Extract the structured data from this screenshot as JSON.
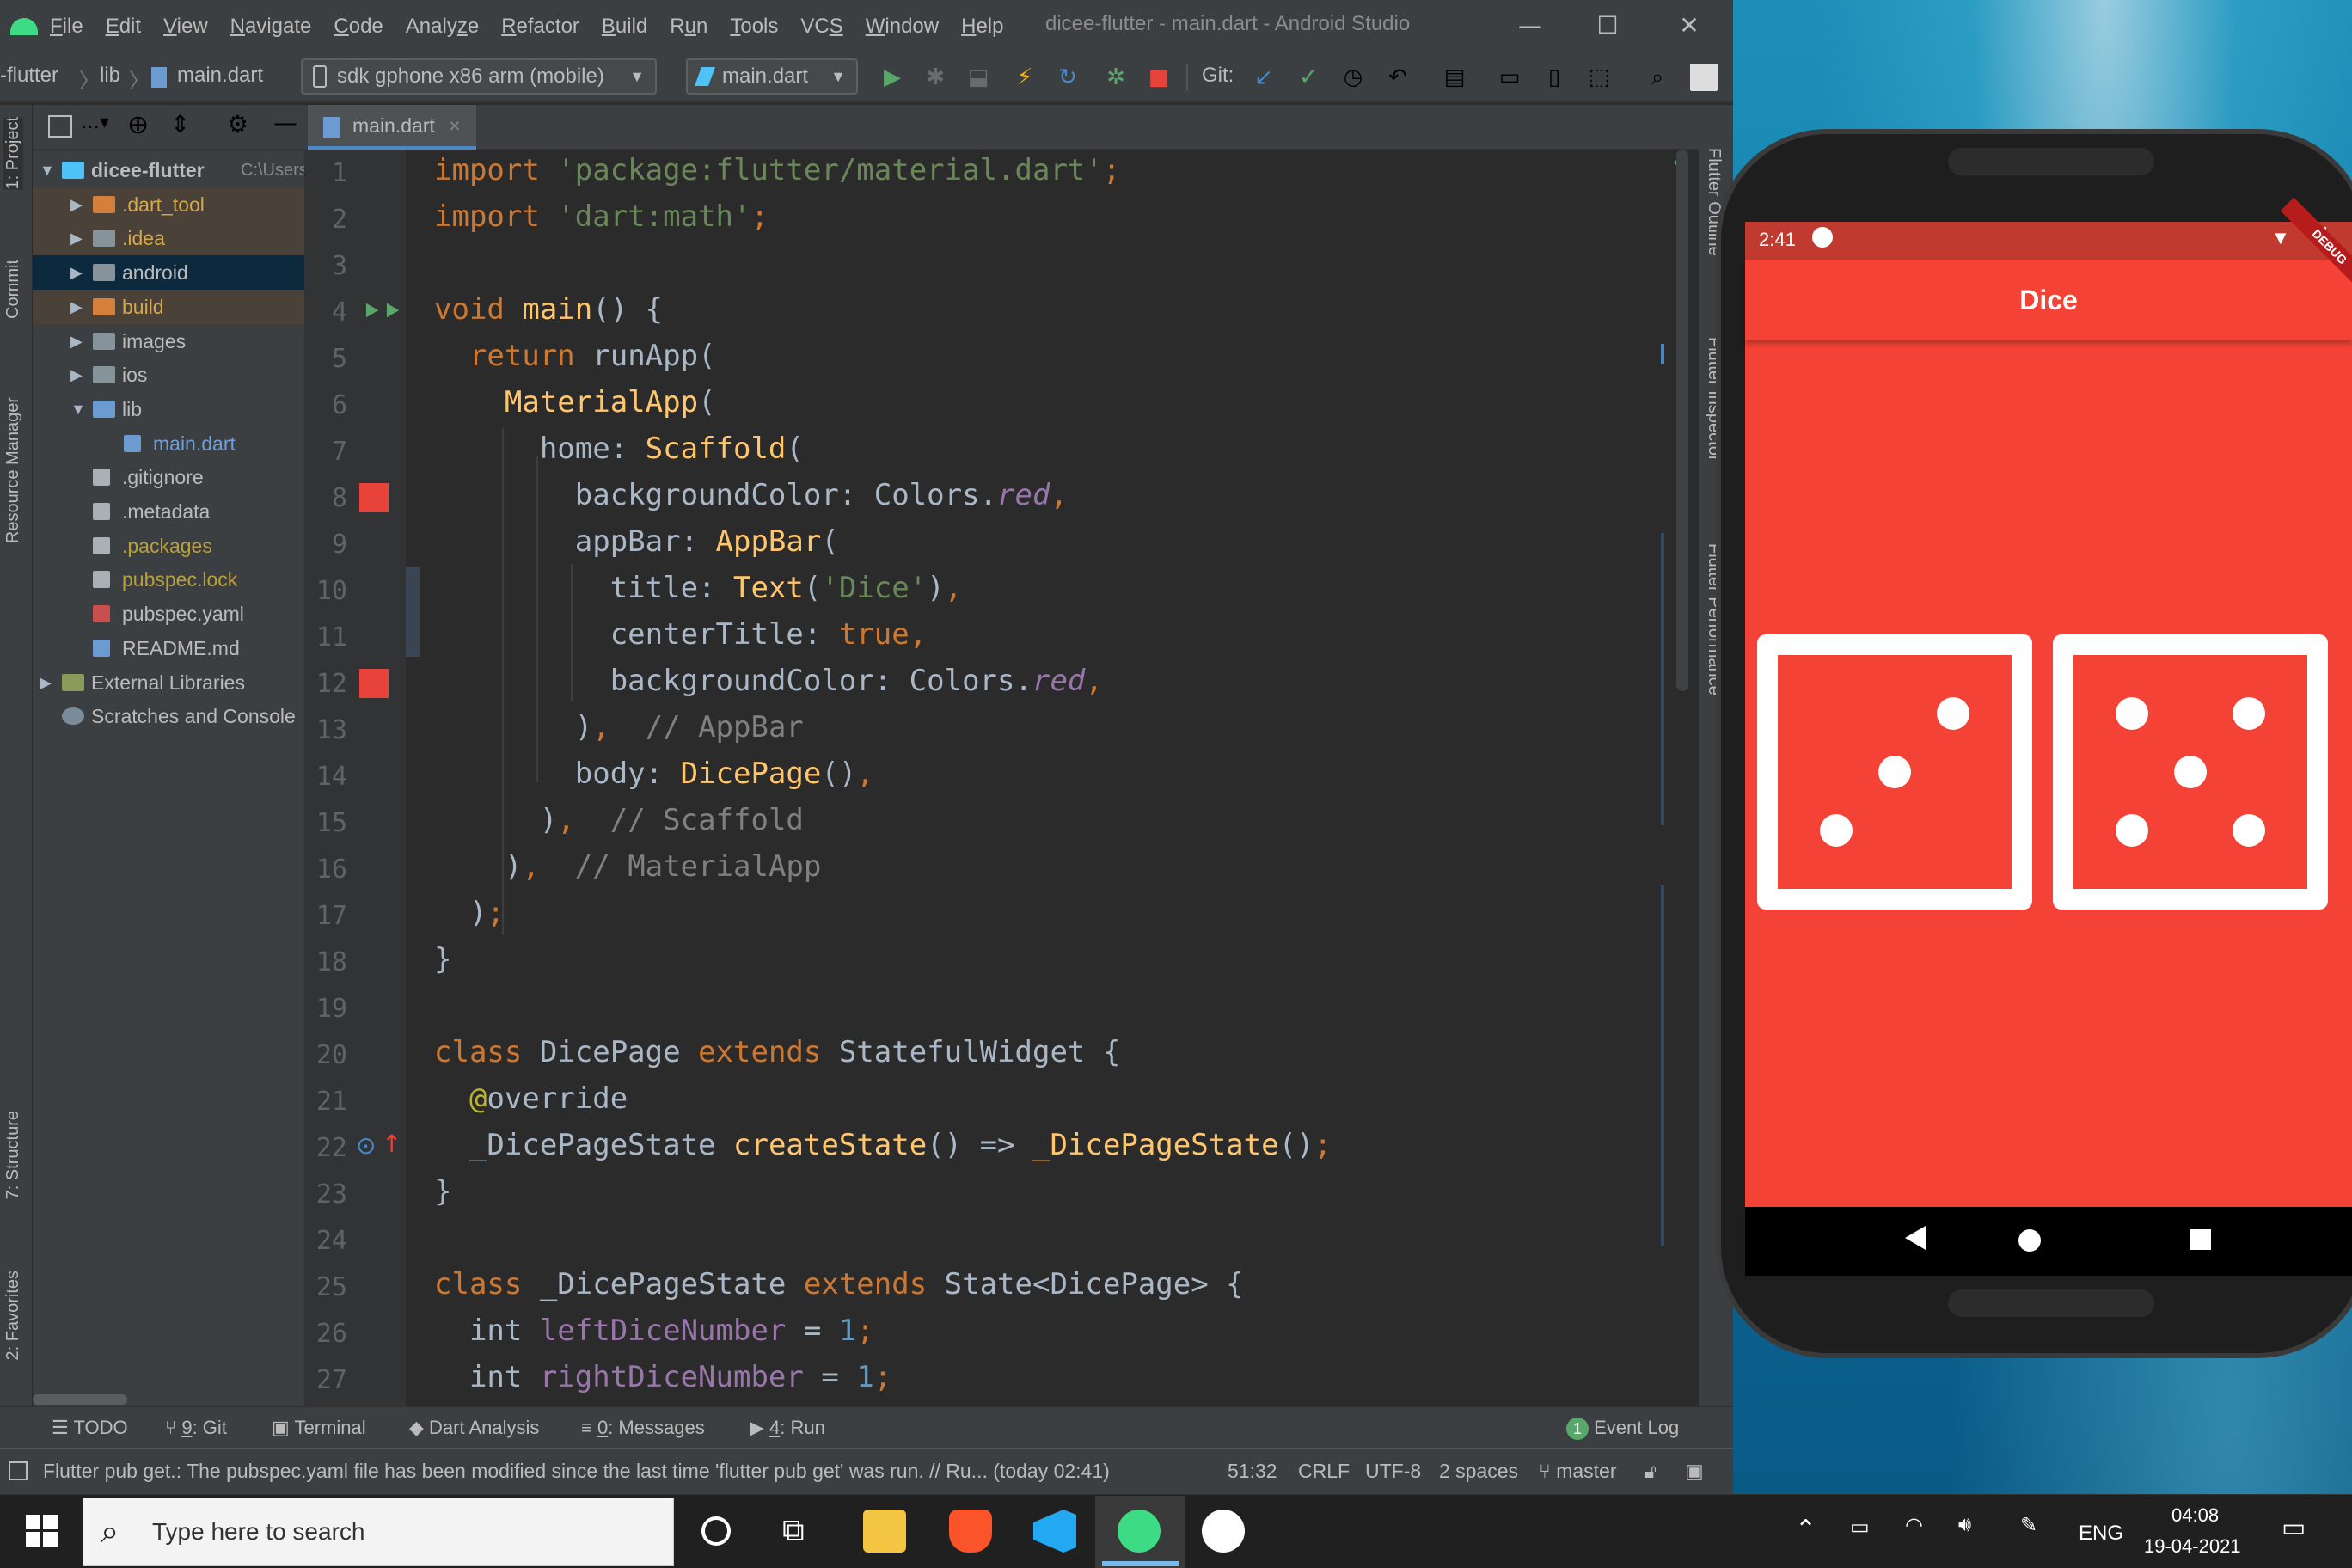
{
  "window": {
    "title": "dicee-flutter - main.dart - Android Studio"
  },
  "menu": [
    "File",
    "Edit",
    "View",
    "Navigate",
    "Code",
    "Analyze",
    "Refactor",
    "Build",
    "Run",
    "Tools",
    "VCS",
    "Window",
    "Help"
  ],
  "menu_mnemonics": [
    "F",
    "E",
    "V",
    "N",
    "C",
    "z",
    "R",
    "B",
    "u",
    "T",
    "S",
    "W",
    "H"
  ],
  "breadcrumb": {
    "project": "-flutter",
    "folder": "lib",
    "file": "main.dart"
  },
  "toolbar": {
    "device": "sdk gphone x86 arm (mobile)",
    "run_config": "main.dart",
    "git_label": "Git:"
  },
  "left_stripe": {
    "project": "1: Project",
    "commit": "Commit",
    "resource_manager": "Resource Manager",
    "structure": "7: Structure",
    "favorites": "2: Favorites"
  },
  "right_stripe": {
    "outline": "Flutter Outline",
    "inspector": "Flutter Inspector",
    "performance": "Flutter Performance"
  },
  "project_tree": [
    {
      "label": "dicee-flutter",
      "extra": "C:\\Users",
      "depth": 0,
      "arrow": "▼",
      "kind": "module",
      "state": "root"
    },
    {
      "label": ".dart_tool",
      "depth": 1,
      "arrow": "▶",
      "kind": "folder-orange",
      "state": "excluded"
    },
    {
      "label": ".idea",
      "depth": 1,
      "arrow": "▶",
      "kind": "folder",
      "state": "excluded"
    },
    {
      "label": "android",
      "depth": 1,
      "arrow": "▶",
      "kind": "folder",
      "state": "selected"
    },
    {
      "label": "build",
      "depth": 1,
      "arrow": "▶",
      "kind": "folder-orange",
      "state": "excluded"
    },
    {
      "label": "images",
      "depth": 1,
      "arrow": "▶",
      "kind": "folder",
      "state": "normal"
    },
    {
      "label": "ios",
      "depth": 1,
      "arrow": "▶",
      "kind": "folder",
      "state": "normal"
    },
    {
      "label": "lib",
      "depth": 1,
      "arrow": "▼",
      "kind": "folder-blue",
      "state": "normal"
    },
    {
      "label": "main.dart",
      "depth": 2,
      "arrow": "",
      "kind": "dart",
      "state": "dart"
    },
    {
      "label": ".gitignore",
      "depth": 1,
      "arrow": "",
      "kind": "file",
      "state": "normal"
    },
    {
      "label": ".metadata",
      "depth": 1,
      "arrow": "",
      "kind": "file",
      "state": "normal"
    },
    {
      "label": ".packages",
      "depth": 1,
      "arrow": "",
      "kind": "file",
      "state": "ignored"
    },
    {
      "label": "pubspec.lock",
      "depth": 1,
      "arrow": "",
      "kind": "file",
      "state": "ignored"
    },
    {
      "label": "pubspec.yaml",
      "depth": 1,
      "arrow": "",
      "kind": "yaml",
      "state": "normal"
    },
    {
      "label": "README.md",
      "depth": 1,
      "arrow": "",
      "kind": "md",
      "state": "normal"
    },
    {
      "label": "External Libraries",
      "depth": 0,
      "arrow": "▶",
      "kind": "lib",
      "state": "normal"
    },
    {
      "label": "Scratches and Console",
      "depth": 0,
      "arrow": "",
      "kind": "scratch",
      "state": "normal"
    }
  ],
  "editor_tab": "main.dart",
  "code_lines": [
    [
      [
        "k",
        "import "
      ],
      [
        "s",
        "'package:flutter/material.dart'"
      ],
      [
        "k",
        ";"
      ]
    ],
    [
      [
        "k",
        "import "
      ],
      [
        "s",
        "'dart:math'"
      ],
      [
        "k",
        ";"
      ]
    ],
    [],
    [
      [
        "k",
        "void "
      ],
      [
        "f",
        "main"
      ],
      [
        "t",
        "() {"
      ]
    ],
    [
      [
        "t",
        "  "
      ],
      [
        "k",
        "return "
      ],
      [
        "t",
        "runApp("
      ]
    ],
    [
      [
        "t",
        "    "
      ],
      [
        "f",
        "MaterialApp"
      ],
      [
        "t",
        "("
      ]
    ],
    [
      [
        "t",
        "      home: "
      ],
      [
        "f",
        "Scaffold"
      ],
      [
        "t",
        "("
      ]
    ],
    [
      [
        "t",
        "        backgroundColor: Colors."
      ],
      [
        "p",
        "red"
      ],
      [
        "k",
        ","
      ]
    ],
    [
      [
        "t",
        "        appBar: "
      ],
      [
        "f",
        "AppBar"
      ],
      [
        "t",
        "("
      ]
    ],
    [
      [
        "t",
        "          title: "
      ],
      [
        "f",
        "Text"
      ],
      [
        "t",
        "("
      ],
      [
        "s",
        "'Dice'"
      ],
      [
        "t",
        ")"
      ],
      [
        "k",
        ","
      ]
    ],
    [
      [
        "t",
        "          centerTitle: "
      ],
      [
        "k",
        "true,"
      ]
    ],
    [
      [
        "t",
        "          backgroundColor: Colors."
      ],
      [
        "p",
        "red"
      ],
      [
        "k",
        ","
      ]
    ],
    [
      [
        "t",
        "        )"
      ],
      [
        "k",
        ",  "
      ],
      [
        "c",
        "// AppBar"
      ]
    ],
    [
      [
        "t",
        "        body: "
      ],
      [
        "f",
        "DicePage"
      ],
      [
        "t",
        "()"
      ],
      [
        "k",
        ","
      ]
    ],
    [
      [
        "t",
        "      )"
      ],
      [
        "k",
        ",  "
      ],
      [
        "c",
        "// Scaffold"
      ]
    ],
    [
      [
        "t",
        "    )"
      ],
      [
        "k",
        ",  "
      ],
      [
        "c",
        "// MaterialApp"
      ]
    ],
    [
      [
        "t",
        "  )"
      ],
      [
        "k",
        ";"
      ]
    ],
    [
      [
        "t",
        "}"
      ]
    ],
    [],
    [
      [
        "k",
        "class "
      ],
      [
        "t",
        "DicePage "
      ],
      [
        "k",
        "extends "
      ],
      [
        "t",
        "StatefulWidget {"
      ]
    ],
    [
      [
        "t",
        "  "
      ],
      [
        "a",
        "@"
      ],
      [
        "t",
        "override"
      ]
    ],
    [
      [
        "t",
        "  _DicePageState "
      ],
      [
        "f",
        "createState"
      ],
      [
        "t",
        "() => "
      ],
      [
        "f",
        "_DicePageState"
      ],
      [
        "t",
        "()"
      ],
      [
        "k",
        ";"
      ]
    ],
    [
      [
        "t",
        "}"
      ]
    ],
    [],
    [
      [
        "k",
        "class "
      ],
      [
        "t",
        "_DicePageState "
      ],
      [
        "k",
        "extends "
      ],
      [
        "t",
        "State<DicePage> {"
      ]
    ],
    [
      [
        "t",
        "  int "
      ],
      [
        "v",
        "leftDiceNumber"
      ],
      [
        "t",
        " = "
      ],
      [
        "n",
        "1"
      ],
      [
        "k",
        ";"
      ]
    ],
    [
      [
        "t",
        "  int "
      ],
      [
        "v",
        "rightDiceNumber"
      ],
      [
        "t",
        " = "
      ],
      [
        "n",
        "1"
      ],
      [
        "k",
        ";"
      ]
    ]
  ],
  "bottom_tabs": [
    {
      "num": "",
      "label": "TODO"
    },
    {
      "num": "9",
      "label": ": Git"
    },
    {
      "num": "",
      "label": "Terminal"
    },
    {
      "num": "",
      "label": "Dart Analysis"
    },
    {
      "num": "0",
      "label": ": Messages"
    },
    {
      "num": "4",
      "label": ": Run"
    }
  ],
  "event_log": {
    "count": "1",
    "label": "Event Log"
  },
  "status": {
    "message": "Flutter pub get.: The pubspec.yaml file has been modified since the last time 'flutter pub get' was run. // Ru... (today 02:41)",
    "position": "51:32",
    "line_sep": "CRLF",
    "encoding": "UTF-8",
    "indent": "2 spaces",
    "branch": "master"
  },
  "phone": {
    "time": "2:41",
    "title": "Dice",
    "debug_banner": "DEBUG",
    "dice": [
      3,
      5
    ]
  },
  "taskbar": {
    "search_placeholder": "Type here to search",
    "lang": "ENG",
    "time": "04:08",
    "date": "19-04-2021"
  },
  "colors": {
    "accent": "#4a88c7",
    "appbar": "#f44336",
    "run_green": "#59a869"
  }
}
